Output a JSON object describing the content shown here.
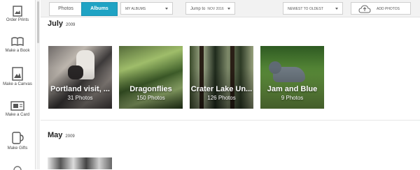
{
  "rail": {
    "items": [
      {
        "label": "Order Prints",
        "icon": "photo-icon"
      },
      {
        "label": "Make a Book",
        "icon": "book-icon"
      },
      {
        "label": "Make a Canvas",
        "icon": "canvas-icon"
      },
      {
        "label": "Make a Card",
        "icon": "card-icon"
      },
      {
        "label": "Make Gifts",
        "icon": "mug-icon"
      }
    ]
  },
  "toolbar": {
    "photos_tab": "Photos",
    "albums_tab": "Albums",
    "albums_dropdown": "MY ALBUMS",
    "jump_label": "Jump to",
    "jump_value": "NOV 2016",
    "sort_dropdown": "NEWEST TO OLDEST",
    "add_photos": "ADD PHOTOS",
    "accent_color": "#1fa3c4"
  },
  "sections": [
    {
      "month": "July",
      "year": "2009",
      "albums": [
        {
          "title": "Portland visit, ...",
          "count": "31 Photos"
        },
        {
          "title": "Dragonflies",
          "count": "150 Photos"
        },
        {
          "title": "Crater Lake Un...",
          "count": "126 Photos"
        },
        {
          "title": "Jam and Blue",
          "count": "9 Photos"
        }
      ]
    },
    {
      "month": "May",
      "year": "2009",
      "albums": []
    }
  ]
}
